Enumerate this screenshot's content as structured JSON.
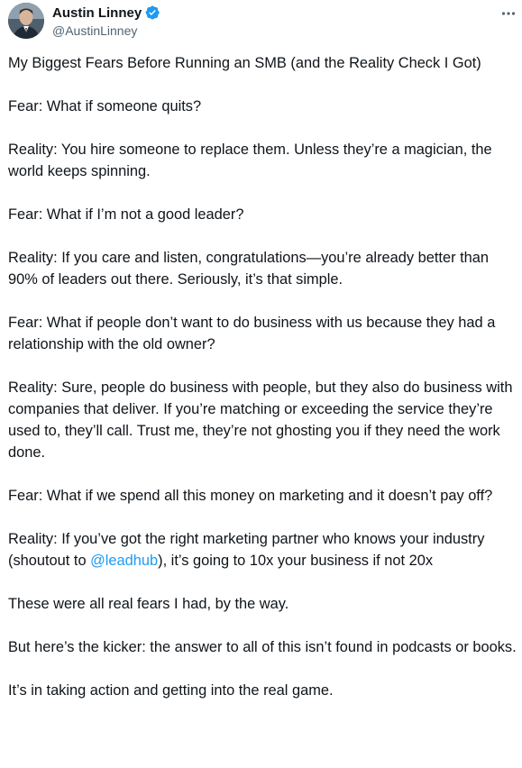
{
  "author": {
    "display_name": "Austin Linney",
    "handle": "@AustinLinney",
    "verified_color": "#1d9bf0",
    "avatar_icon": "profile-photo"
  },
  "actions": {
    "more_icon": "more-horizontal-icon"
  },
  "tweet": {
    "p1": "My Biggest Fears Before Running an SMB (and the Reality Check I Got)",
    "p2": "Fear: What if someone quits?",
    "p3": "Reality: You hire someone to replace them. Unless they’re a magician, the world keeps spinning.",
    "p4": "Fear: What if I’m not a good leader?",
    "p5": "Reality: If you care and listen, congratulations—you’re already better than 90% of leaders out there. Seriously, it’s that simple.",
    "p6": "Fear: What if people don’t want to do business with us because they had a relationship with the old owner?",
    "p7": "Reality: Sure, people do business with people, but they also do business with companies that deliver. If you’re matching or exceeding the service they’re used to, they’ll call. Trust me, they’re not ghosting you if they need the work done.",
    "p8": "Fear: What if we spend all this money on marketing and it doesn’t pay off?",
    "p9_before": "Reality: If you’ve got the right marketing partner who knows your industry (shoutout to ",
    "p9_mention": "@leadhub",
    "p9_after": "), it’s going to 10x your business if not 20x",
    "p10": "These were all real fears I had, by the way.",
    "p11": "But here’s the kicker: the answer to all of this isn’t found in podcasts or books.",
    "p12": "It’s in taking action and getting into the real game."
  }
}
